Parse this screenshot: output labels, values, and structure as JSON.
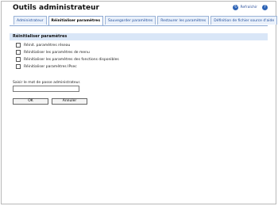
{
  "header": {
    "title": "Outils administrateur",
    "refresh_label": "Refraîchir",
    "refresh_icon": "refresh-icon",
    "help_icon": "help-icon"
  },
  "tabs": [
    {
      "label": "Administrateur",
      "active": false
    },
    {
      "label": "Réinitialiser paramètres",
      "active": true
    },
    {
      "label": "Sauvegarder paramètres",
      "active": false
    },
    {
      "label": "Restaurer les paramètres",
      "active": false
    },
    {
      "label": "Définition de fichier source d'aide",
      "active": false
    }
  ],
  "section": {
    "title": "Réinitialiser paramètres",
    "options": [
      {
        "label": "Réinit. paramètres réseau",
        "checked": false
      },
      {
        "label": "Réinitialiser les paramètres de menu",
        "checked": false
      },
      {
        "label": "Réinitialiser les paramètres des fonctions disponibles",
        "checked": false
      },
      {
        "label": "Réinitialiser paramètres IPsec",
        "checked": false
      }
    ]
  },
  "password": {
    "label": "Saisir le mot de passe administrateur.",
    "value": ""
  },
  "buttons": {
    "ok": "OK",
    "cancel": "Annuler"
  },
  "colors": {
    "tab_border": "#8aa7d2",
    "section_bar": "#d9e6f7",
    "link": "#2a4f9a"
  }
}
